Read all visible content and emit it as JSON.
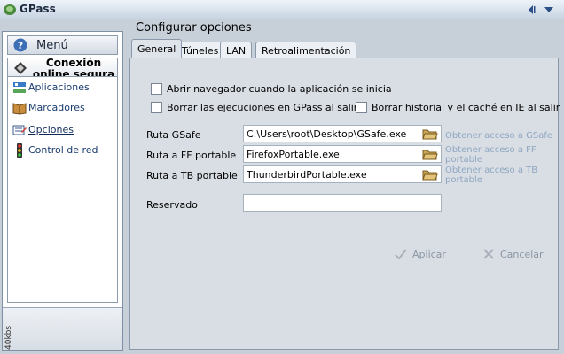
{
  "window": {
    "title": "GPass"
  },
  "sidebar": {
    "menu_label": "Menú",
    "connection_label": "Conexión online segura",
    "items": [
      {
        "label": "Aplicaciones",
        "icon": "applications-icon"
      },
      {
        "label": "Marcadores",
        "icon": "bookmarks-icon"
      },
      {
        "label": "Opciones",
        "icon": "options-icon",
        "active": true
      },
      {
        "label": "Control de red",
        "icon": "traffic-light-icon"
      }
    ],
    "bandwidth": "40kbs"
  },
  "main": {
    "title": "Configurar opciones",
    "tabs": [
      {
        "label": "General",
        "active": true
      },
      {
        "label": "Túneles"
      },
      {
        "label": "LAN"
      },
      {
        "label": "Retroalimentación"
      }
    ],
    "checkboxes": {
      "open_browser": {
        "label": "Abrir navegador cuando la aplicación se inicia",
        "checked": false
      },
      "clear_runs": {
        "label": "Borrar las ejecuciones en GPass al salir",
        "checked": false
      },
      "clear_history": {
        "label": "Borrar historial y el caché en IE al salir",
        "checked": false
      }
    },
    "fields": {
      "gsafe": {
        "label": "Ruta GSafe",
        "value": "C:\\Users\\root\\Desktop\\GSafe.exe",
        "link": "Obtener acceso a GSafe"
      },
      "ff": {
        "label": "Ruta a FF portable",
        "value": "FirefoxPortable.exe",
        "link": "Obtener acceso a FF portable"
      },
      "tb": {
        "label": "Ruta a TB portable",
        "value": "ThunderbirdPortable.exe",
        "link": "Obtener acceso a TB portable"
      },
      "reserved": {
        "label": "Reservado",
        "value": ""
      }
    },
    "buttons": {
      "apply": "Aplicar",
      "cancel": "Cancelar"
    }
  },
  "colors": {
    "background": "#c7cfd8",
    "panel": "#d9dee4",
    "link": "#8fa7c2",
    "disabled_text": "#8b96a3"
  }
}
